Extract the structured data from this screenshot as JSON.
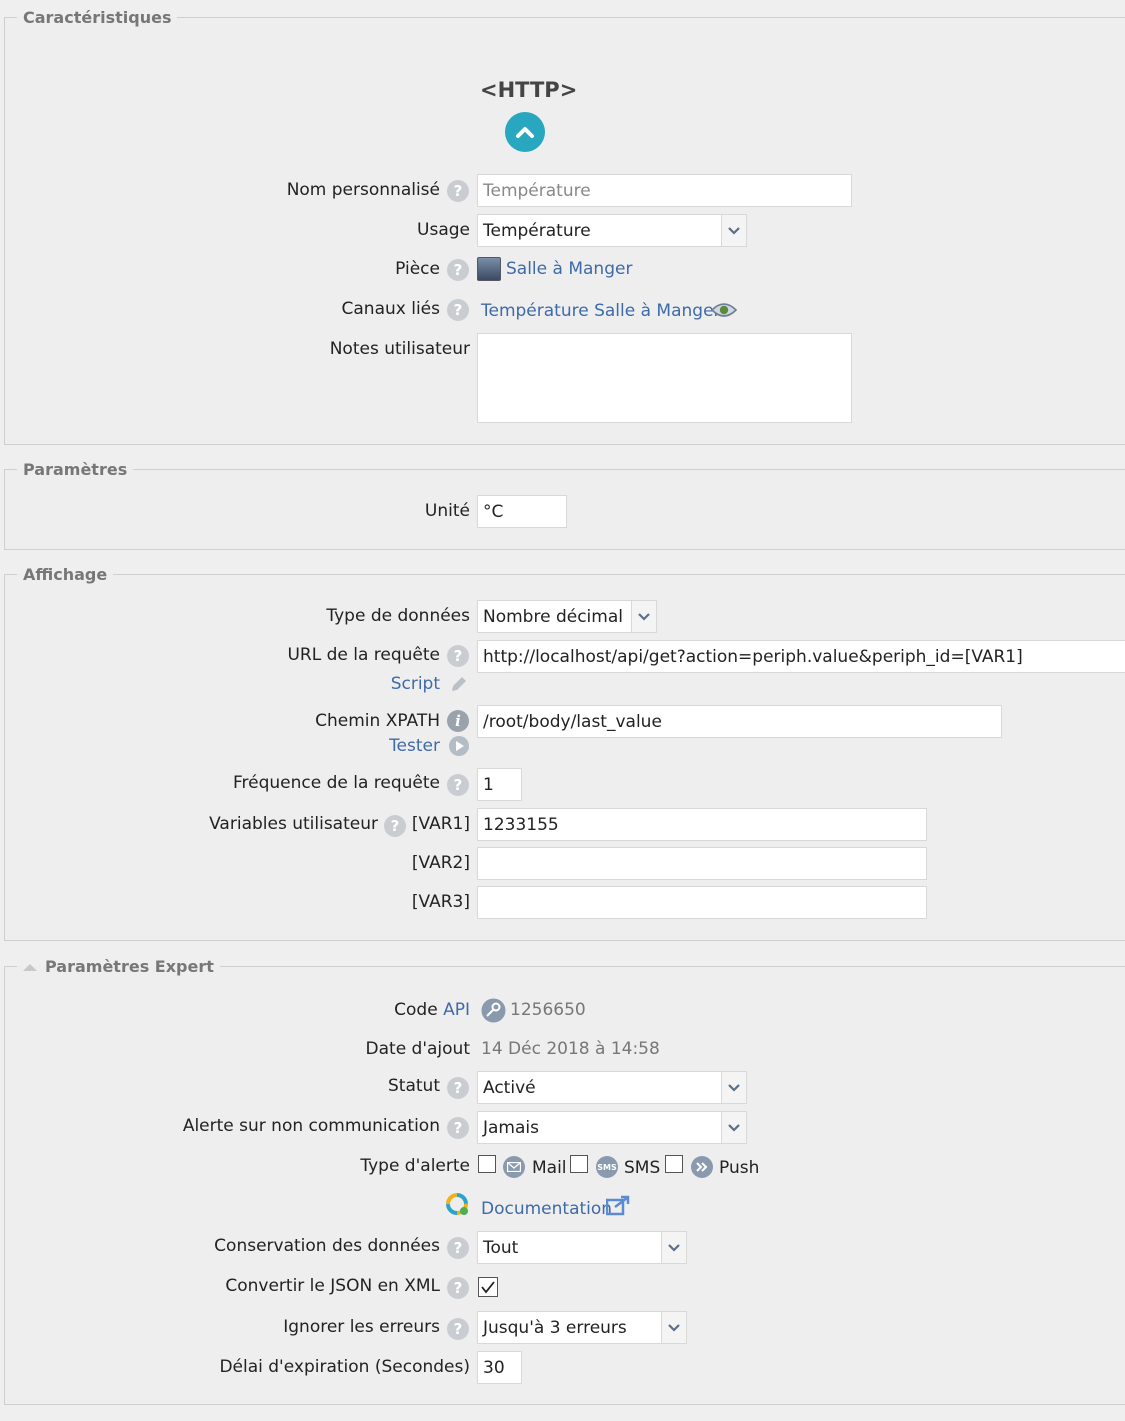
{
  "sections": {
    "caracteristiques": "Caractéristiques",
    "parametres": "Paramètres",
    "affichage": "Affichage",
    "expert": "Paramètres Expert"
  },
  "device": {
    "type": "<HTTP>"
  },
  "caracteristiques": {
    "nom_label": "Nom personnalisé",
    "nom_placeholder": "Température",
    "usage_label": "Usage",
    "usage_value": "Température",
    "piece_label": "Pièce",
    "piece_value": "Salle à Manger",
    "canaux_label": "Canaux liés",
    "canaux_value": "Température Salle à Manger",
    "notes_label": "Notes utilisateur",
    "notes_value": ""
  },
  "parametres": {
    "unite_label": "Unité",
    "unite_value": "°C"
  },
  "affichage": {
    "type_label": "Type de données",
    "type_value": "Nombre décimal",
    "url_label": "URL de la requête",
    "url_value": "http://localhost/api/get?action=periph.value&periph_id=[VAR1]",
    "script_link": "Script",
    "xpath_label": "Chemin XPATH",
    "xpath_value": "/root/body/last_value",
    "tester_link": "Tester",
    "freq_label": "Fréquence de la requête",
    "freq_value": "1",
    "vars_label": "Variables utilisateur",
    "var1_label": "[VAR1]",
    "var1_value": "1233155",
    "var2_label": "[VAR2]",
    "var2_value": "",
    "var3_label": "[VAR3]",
    "var3_value": ""
  },
  "expert": {
    "code_label": "Code",
    "api_link": "API",
    "code_value": "1256650",
    "date_label": "Date d'ajout",
    "date_value": "14 Déc 2018 à 14:58",
    "statut_label": "Statut",
    "statut_value": "Activé",
    "alerte_label": "Alerte sur non communication",
    "alerte_value": "Jamais",
    "type_alerte_label": "Type d'alerte",
    "mail_label": "Mail",
    "sms_label": "SMS",
    "sms_icon_text": "SMS",
    "push_label": "Push",
    "doc_link": "Documentation",
    "conservation_label": "Conservation des données",
    "conservation_value": "Tout",
    "json_label": "Convertir le JSON en XML",
    "json_checked": true,
    "ignorer_label": "Ignorer les erreurs",
    "ignorer_value": "Jusqu'à 3 erreurs",
    "delai_label": "Délai d'expiration (Secondes)",
    "delai_value": "30"
  },
  "icons": {
    "help": "question-circle-icon",
    "collapse": "chevron-up-circle-icon",
    "dropdown": "chevron-down-icon",
    "edit": "pencil-icon",
    "play": "play-circle-icon",
    "eye": "eye-icon",
    "key": "key-icon",
    "mail": "envelope-icon",
    "push": "double-chevron-icon",
    "external": "external-link-icon",
    "docs": "help-ring-icon"
  },
  "colors": {
    "link": "#3f6aa8",
    "teal_button": "#29a6c0",
    "help_icon": "#c9cdd2",
    "background": "#eeeeee"
  }
}
